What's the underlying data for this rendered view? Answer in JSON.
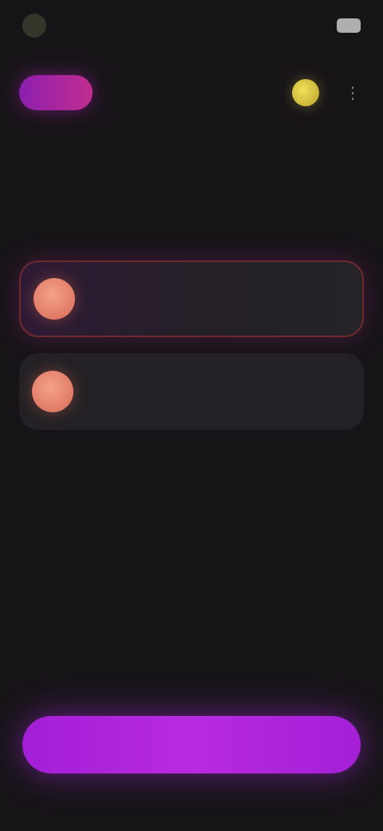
{
  "status_bar": {
    "time": "",
    "right_text": ""
  },
  "top_bar": {
    "brand": "",
    "coins": "",
    "menu_icon": "more-icon"
  },
  "heading": {
    "title": "",
    "subtitle": ""
  },
  "options": [
    {
      "title": "",
      "subtitle": "",
      "selected": true
    },
    {
      "title": "",
      "subtitle": "",
      "selected": false
    }
  ],
  "cta": {
    "label": ""
  },
  "colors": {
    "background": "#171418",
    "accent": "#b02ae0",
    "card": "#232125",
    "selected_border": "#6d2a2c",
    "avatar": "#e57e68",
    "coin": "#e0cc4a"
  }
}
